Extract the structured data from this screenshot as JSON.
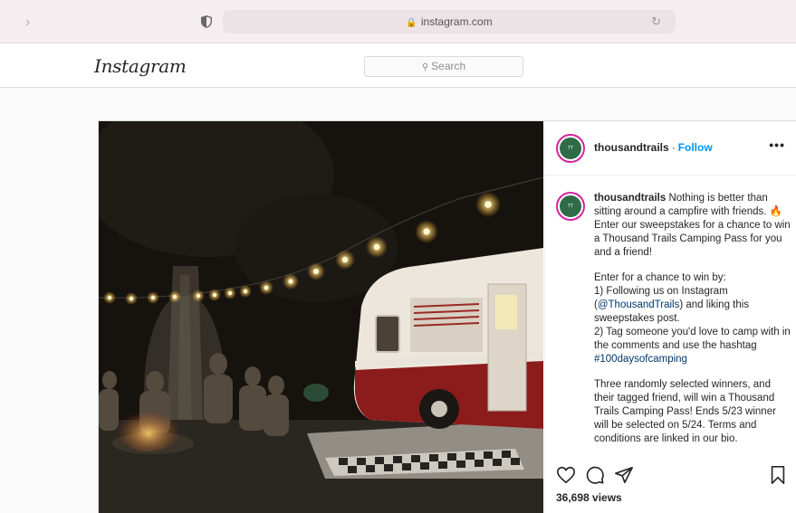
{
  "browser": {
    "url": "instagram.com"
  },
  "header": {
    "logo": "Instagram",
    "search_placeholder": "Search"
  },
  "post": {
    "username": "thousandtrails",
    "follow_label": "Follow",
    "more_label": "•••",
    "caption_user": "thousandtrails",
    "caption_line1": "Nothing is better than sitting around a campfire with friends. 🔥 Enter our sweepstakes for a chance to win a Thousand Trails Camping Pass for you and a friend!",
    "caption_p2_a": "Enter for a chance to win by:",
    "caption_p2_b": "1) Following us on Instagram (",
    "caption_mention": "@ThousandTrails",
    "caption_p2_c": ") and liking this sweepstakes post.",
    "caption_p2_d": "2) Tag someone you'd love to camp with in the comments and use the hashtag ",
    "caption_hashtag": "#100daysofcamping",
    "caption_p3": "Three randomly selected winners, and their tagged friend, will win a Thousand Trails Camping Pass! Ends 5/23 winner will be selected on 5/24. Terms and conditions are linked in our bio.",
    "views": "36,698 views"
  },
  "icons": [
    "forward-icon",
    "shield-icon",
    "lock-icon",
    "reload-icon",
    "search-icon",
    "heart-icon",
    "comment-icon",
    "share-icon",
    "bookmark-icon"
  ]
}
